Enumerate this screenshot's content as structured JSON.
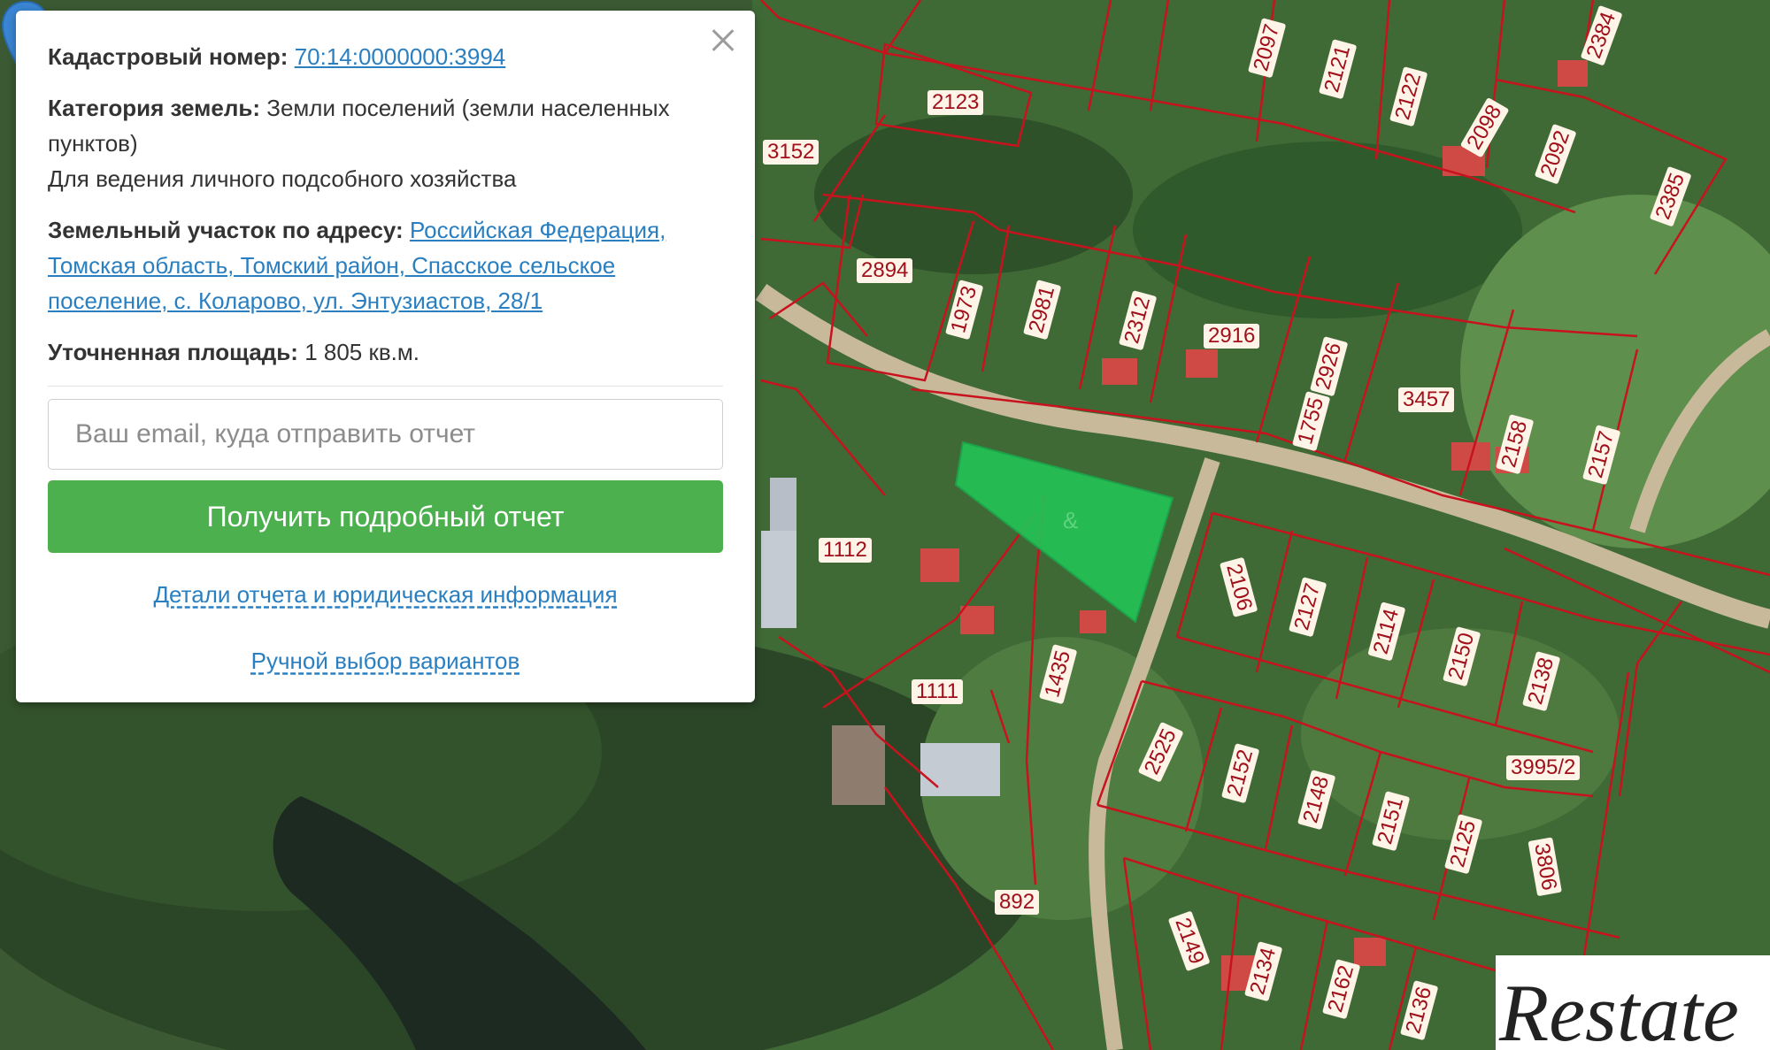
{
  "info_panel": {
    "cadastral_label": "Кадастровый номер:",
    "cadastral_value": "70:14:0000000:3994",
    "category_label": "Категория земель:",
    "category_value": "Земли поселений (земли населенных пунктов)",
    "usage": "Для ведения личного подсобного хозяйства",
    "address_label": "Земельный участок по адресу:",
    "address_value": "Российская Федерация, Томская область, Томский район, Спасское сельское поселение, с. Коларово, ул. Энтузиастов, 28/1",
    "area_label": "Уточненная площадь:",
    "area_value": "1 805 кв.м.",
    "email_placeholder": "Ваш email, куда отправить отчет",
    "submit_label": "Получить подробный отчет",
    "details_link": "Детали отчета и юридическая информация",
    "manual_link": "Ручной выбор вариантов"
  },
  "map": {
    "parcel_numbers": [
      "2123",
      "3152",
      "2097",
      "2121",
      "2122",
      "2098",
      "2092",
      "2384",
      "2385",
      "2894",
      "1973",
      "2981",
      "2312",
      "2916",
      "1755",
      "2926",
      "3457",
      "2158",
      "2157",
      "1112",
      "1111",
      "1435",
      "2106",
      "2127",
      "2114",
      "2150",
      "2138",
      "2525",
      "2152",
      "2148",
      "2151",
      "2125",
      "3995/2",
      "3806",
      "892",
      "2149",
      "2134",
      "2162",
      "2136"
    ],
    "selected_parcel_fragment": "&",
    "colors": {
      "boundary": "#c8121e",
      "selected_parcel": "#22c455",
      "pin": "#3a86d4"
    }
  },
  "watermark": {
    "brand_text": "Restate"
  }
}
